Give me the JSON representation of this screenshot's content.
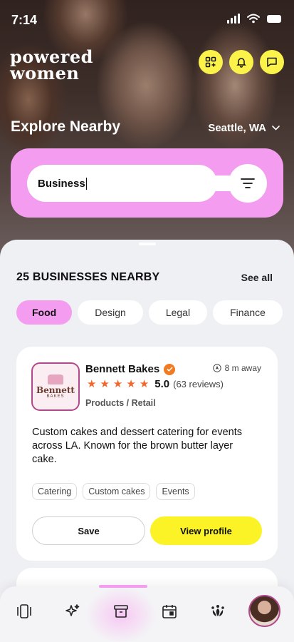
{
  "status": {
    "time": "7:14"
  },
  "brand": {
    "line1": "powered",
    "line2": "women"
  },
  "hero": {
    "title": "Explore Nearby",
    "location": "Seattle, WA"
  },
  "search": {
    "value": "Business"
  },
  "section": {
    "title": "25 BUSINESSES NEARBY",
    "see_all": "See all"
  },
  "categories": [
    "Food",
    "Design",
    "Legal",
    "Finance"
  ],
  "business": {
    "logo_text": "Bennett",
    "logo_sub": "BAKES",
    "name": "Bennett Bakes",
    "distance": "8 m away",
    "rating": "5.0",
    "reviews": "(63 reviews)",
    "category": "Products / Retail",
    "description": "Custom cakes and dessert catering for events across LA. Known for the brown butter layer cake.",
    "tags": [
      "Catering",
      "Custom cakes",
      "Events"
    ],
    "save_label": "Save",
    "view_label": "View profile"
  },
  "colors": {
    "pink": "#f49cf0",
    "yellow": "#fbf326",
    "star": "#f2682a"
  },
  "tabs": [
    "cards-icon",
    "sparkle-icon",
    "box-icon",
    "calendar-icon",
    "community-icon",
    "profile-avatar"
  ]
}
